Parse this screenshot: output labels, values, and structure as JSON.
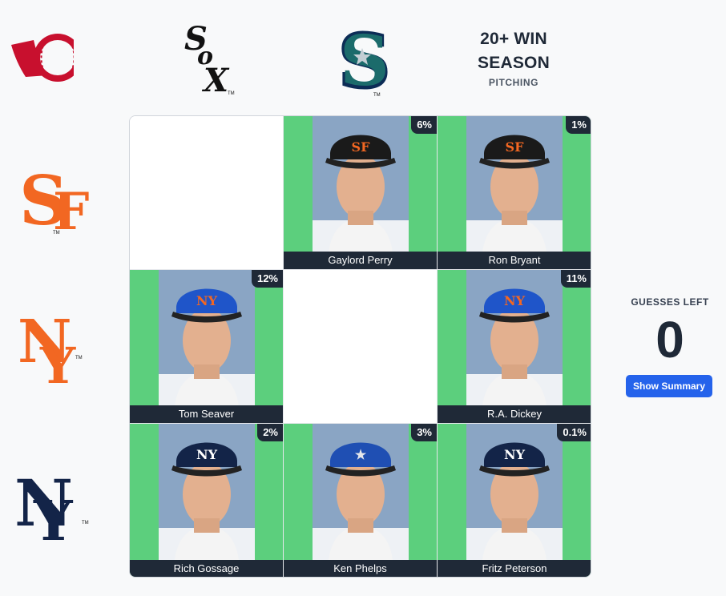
{
  "header": {
    "brand_logo_icon": "baseball-brand-logo",
    "columns": [
      {
        "type": "team",
        "icon": "white-sox-logo",
        "tm": "TM",
        "color": "#111111"
      },
      {
        "type": "team",
        "icon": "mariners-logo",
        "tm": "TM",
        "color": "#1b6b6b"
      },
      {
        "type": "criteria",
        "title_line1": "20+ WIN",
        "title_line2": "SEASON",
        "subtitle": "PITCHING"
      }
    ],
    "rows": [
      {
        "icon": "giants-logo",
        "tm": "TM",
        "color": "#f26722"
      },
      {
        "icon": "mets-logo",
        "tm": "TM",
        "color": "#f26722"
      },
      {
        "icon": "yankees-logo",
        "tm": "TM",
        "color": "#132448"
      }
    ]
  },
  "grid": {
    "cells": [
      {
        "name": "",
        "pct": "",
        "filled": false
      },
      {
        "name": "Gaylord Perry",
        "pct": "6%",
        "filled": true,
        "cap_color": "#1a1a1a",
        "cap_logo": "SF",
        "logo_color": "#f26722"
      },
      {
        "name": "Ron Bryant",
        "pct": "1%",
        "filled": true,
        "cap_color": "#1a1a1a",
        "cap_logo": "SF",
        "logo_color": "#f26722"
      },
      {
        "name": "Tom Seaver",
        "pct": "12%",
        "filled": true,
        "cap_color": "#1f55c9",
        "cap_logo": "NY",
        "logo_color": "#f26722"
      },
      {
        "name": "",
        "pct": "",
        "filled": false
      },
      {
        "name": "R.A. Dickey",
        "pct": "11%",
        "filled": true,
        "cap_color": "#1f55c9",
        "cap_logo": "NY",
        "logo_color": "#f26722"
      },
      {
        "name": "Rich Gossage",
        "pct": "2%",
        "filled": true,
        "cap_color": "#132448",
        "cap_logo": "NY",
        "logo_color": "#ffffff"
      },
      {
        "name": "Ken Phelps",
        "pct": "3%",
        "filled": true,
        "cap_color": "#1f4fb3",
        "cap_logo": "★",
        "logo_color": "#e5e7eb"
      },
      {
        "name": "Fritz Peterson",
        "pct": "0.1%",
        "filled": true,
        "cap_color": "#132448",
        "cap_logo": "NY",
        "logo_color": "#ffffff"
      }
    ]
  },
  "panel": {
    "guesses_label": "GUESSES LEFT",
    "guesses_left": "0",
    "summary_button": "Show Summary"
  }
}
